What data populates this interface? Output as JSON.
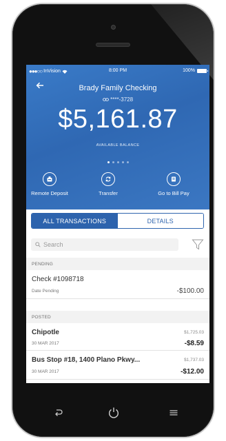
{
  "status_bar": {
    "carrier": "InVision",
    "time": "8:00 PM",
    "battery": "100%"
  },
  "account": {
    "name": "Brady Family Checking",
    "number": "****-3728",
    "balance": "$5,161.87",
    "balance_label": "AVAILABLE BALANCE",
    "page_count": 5,
    "active_page": 1
  },
  "actions": [
    {
      "label": "Remote Deposit",
      "icon": "deposit-icon"
    },
    {
      "label": "Transfer",
      "icon": "transfer-icon"
    },
    {
      "label": "Go to Bill Pay",
      "icon": "bill-pay-icon"
    }
  ],
  "tabs": {
    "all_transactions": "ALL TRANSACTIONS",
    "details": "DETAILS"
  },
  "search": {
    "placeholder": "Search"
  },
  "sections": {
    "pending": "PENDING",
    "posted": "POSTED"
  },
  "pending_transactions": [
    {
      "name": "Check #1098718",
      "date": "Date Pending",
      "amount": "-$100.00"
    }
  ],
  "posted_transactions": [
    {
      "name": "Chipotle",
      "date": "30 MAR 2017",
      "balance": "$1,725.03",
      "amount": "-$8.59"
    },
    {
      "name": "Bus Stop #18, 1400 Plano Pkwy...",
      "date": "30 MAR 2017",
      "balance": "$1,737.03",
      "amount": "-$12.00"
    }
  ],
  "colors": {
    "brand_blue": "#2d63ad",
    "header_blue": "#3a7bc8"
  },
  "device_nav": [
    "back-icon",
    "power-icon",
    "menu-icon"
  ]
}
